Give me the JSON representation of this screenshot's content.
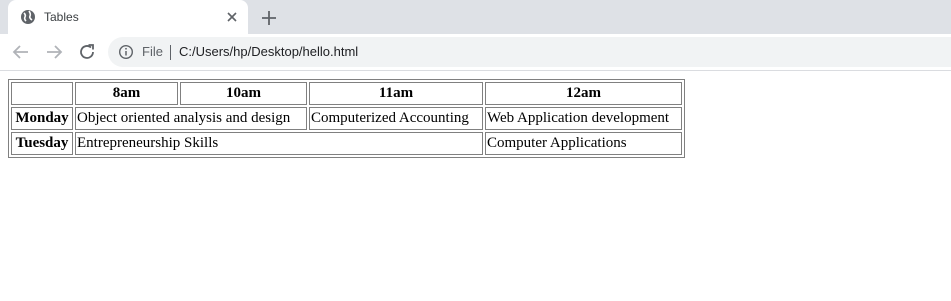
{
  "browser": {
    "tab_title": "Tables",
    "address_scheme_label": "File",
    "address_url": "C:/Users/hp/Desktop/hello.html",
    "icons": {
      "favicon": "globe-icon",
      "tab_close": "close-icon",
      "new_tab": "plus-icon",
      "back": "back-arrow-icon",
      "forward": "forward-arrow-icon",
      "reload": "reload-icon",
      "site_info": "info-icon"
    }
  },
  "table": {
    "headers": [
      "",
      "8am",
      "10am",
      "11am",
      "12am"
    ],
    "rows": [
      {
        "day": "Monday",
        "cells": [
          "Object oriented analysis and design",
          "Computerized Accounting",
          "Web Application development"
        ]
      },
      {
        "day": "Tuesday",
        "cells": [
          "Entrepreneurship Skills",
          "Computer Applications"
        ]
      }
    ]
  }
}
